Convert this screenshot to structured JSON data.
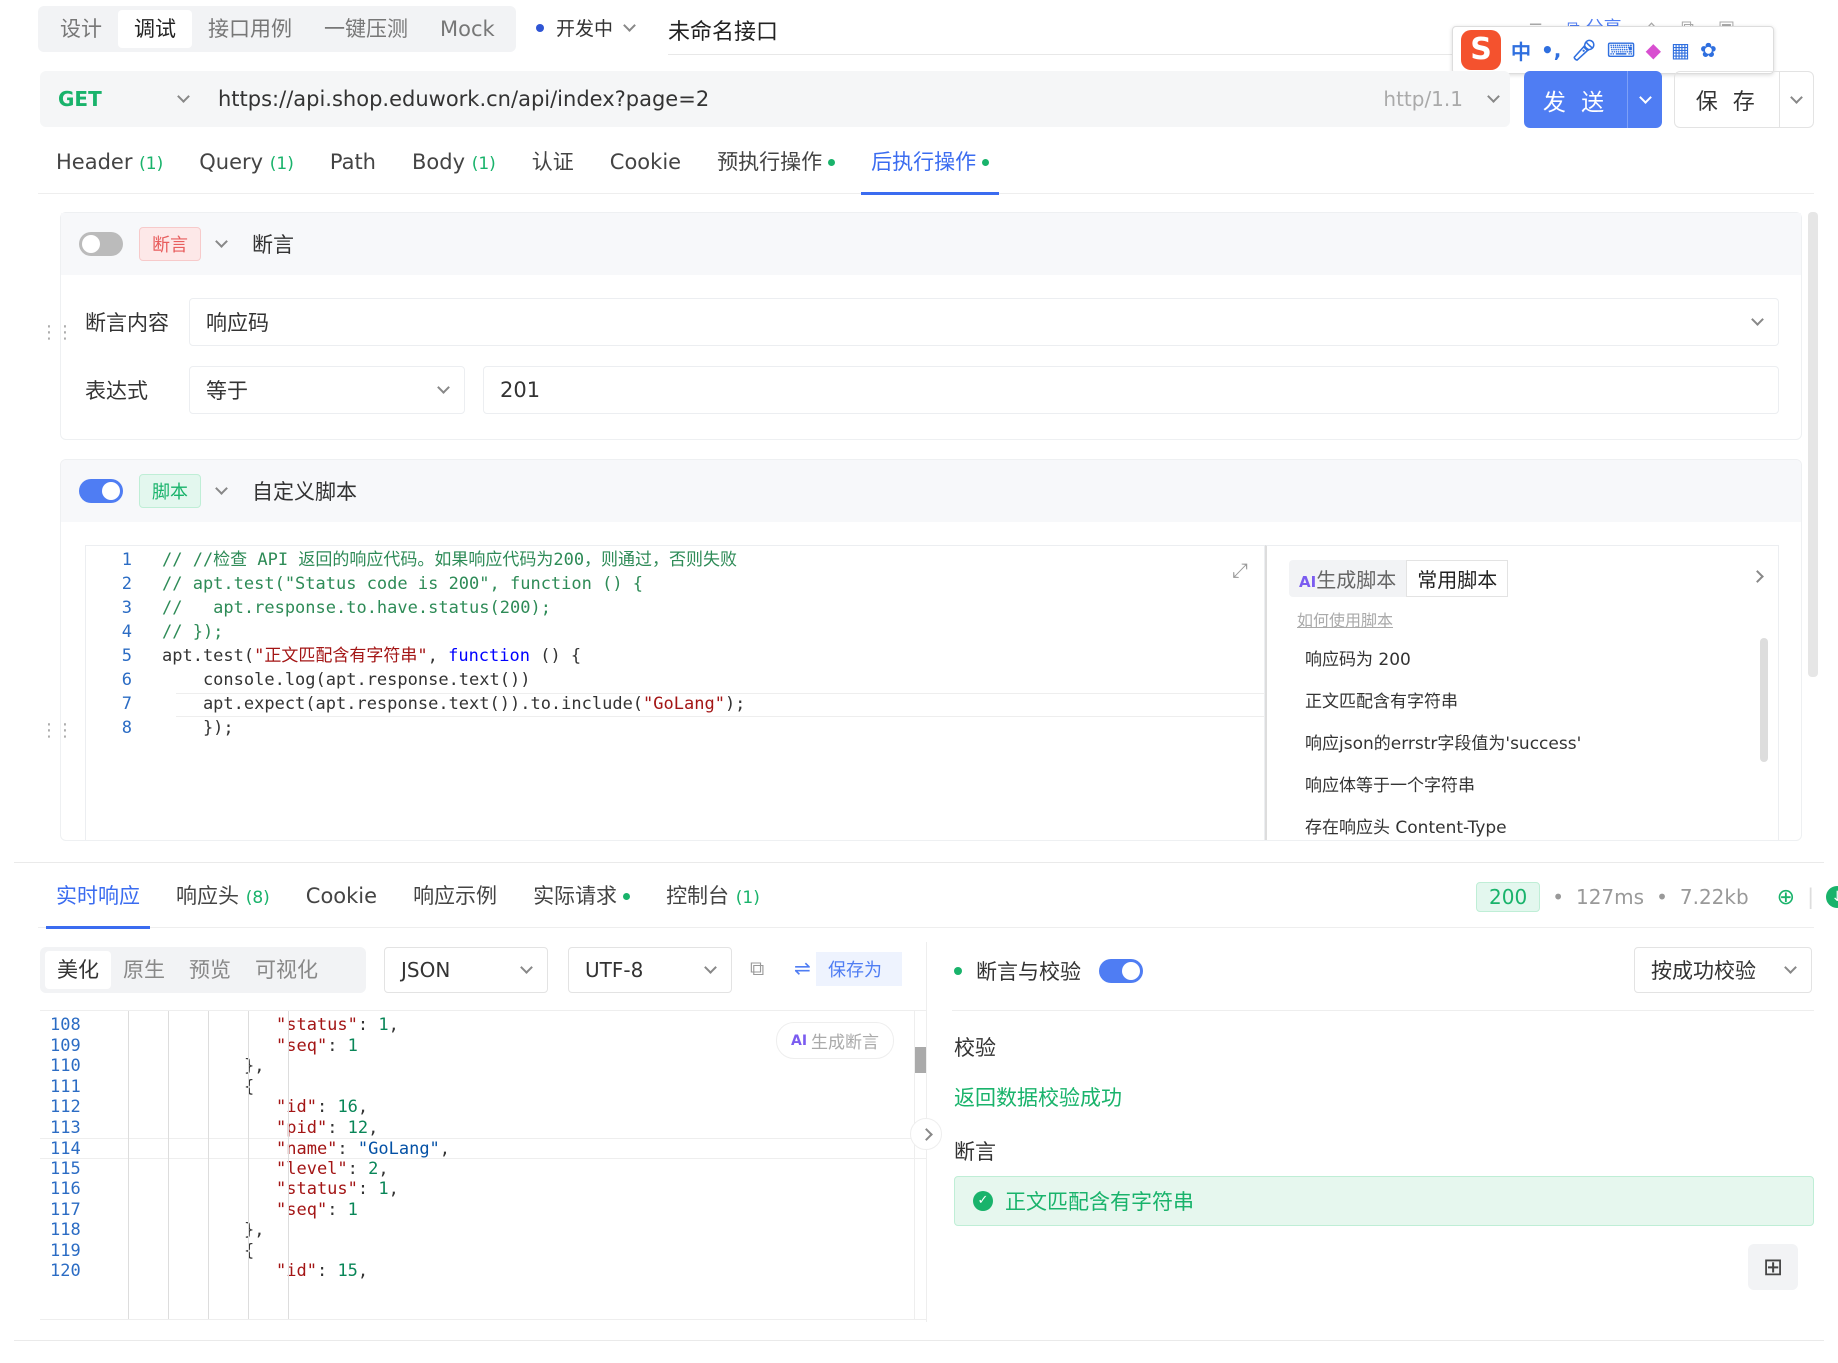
{
  "top_tabs": [
    "设计",
    "调试",
    "接口用例",
    "一键压测",
    "Mock"
  ],
  "active_top_tab": 1,
  "status": {
    "label": "开发中",
    "color": "#2f55d4"
  },
  "api_name": "未命名接口",
  "top_right_labels": {
    "share": "分享"
  },
  "ime": {
    "logo": "S",
    "lang": "中"
  },
  "request": {
    "method": "GET",
    "url": "https://api.shop.eduwork.cn/api/index?page=2",
    "protocol": "http/1.1",
    "send_label": "发 送",
    "save_label": "保 存"
  },
  "req_tabs": [
    {
      "label": "Header",
      "count": "(1)"
    },
    {
      "label": "Query",
      "count": "(1)"
    },
    {
      "label": "Path",
      "count": ""
    },
    {
      "label": "Body",
      "count": "(1)"
    },
    {
      "label": "认证",
      "count": ""
    },
    {
      "label": "Cookie",
      "count": ""
    },
    {
      "label": "预执行操作",
      "count": ""
    },
    {
      "label": "后执行操作",
      "count": ""
    }
  ],
  "assertion": {
    "tag": "断言",
    "title": "断言",
    "content_label": "断言内容",
    "content_value": "响应码",
    "expr_label": "表达式",
    "expr_value": "等于",
    "value": "201"
  },
  "script": {
    "tag": "脚本",
    "title": "自定义脚本",
    "ai_label": "生成脚本",
    "common_label": "常用脚本",
    "help_link": "如何使用脚本",
    "snippets": [
      "响应码为 200",
      "正文匹配含有字符串",
      "响应json的errstr字段值为'success'",
      "响应体等于一个字符串",
      "存在响应头 Content-Type"
    ],
    "code_lines": [
      {
        "n": "1",
        "text": "// //检查 API 返回的响应代码。如果响应代码为200，则通过，否则失败"
      },
      {
        "n": "2",
        "text": "// apt.test(\"Status code is 200\", function () {"
      },
      {
        "n": "3",
        "text": "//   apt.response.to.have.status(200);"
      },
      {
        "n": "4",
        "text": "// });"
      },
      {
        "n": "5",
        "pre": "apt.test(",
        "str": "\"正文匹配含有字符串\"",
        "mid": ", ",
        "kw": "function",
        "post": " () {"
      },
      {
        "n": "6",
        "text": "    console.log(apt.response.text())"
      },
      {
        "n": "7",
        "pre": "    apt.expect(apt.response.text()).to.include(",
        "str": "\"GoLang\"",
        "post": ");"
      },
      {
        "n": "8",
        "text": "    });"
      }
    ]
  },
  "resp_tabs": [
    {
      "label": "实时响应",
      "count": ""
    },
    {
      "label": "响应头",
      "count": "(8)"
    },
    {
      "label": "Cookie",
      "count": ""
    },
    {
      "label": "响应示例",
      "count": ""
    },
    {
      "label": "实际请求",
      "count": ""
    },
    {
      "label": "控制台",
      "count": "(1)"
    }
  ],
  "resp_stats": {
    "code": "200",
    "time": "127ms",
    "size": "7.22kb"
  },
  "view_modes": [
    "美化",
    "原生",
    "预览",
    "可视化"
  ],
  "format": "JSON",
  "encoding": "UTF-8",
  "save_as": "保存为",
  "gen_assert": "生成断言",
  "json_lines": [
    {
      "n": "108",
      "indent": 4,
      "k": "\"status\"",
      "v": "1",
      "t": "n",
      "tail": ","
    },
    {
      "n": "109",
      "indent": 4,
      "k": "\"seq\"",
      "v": "1",
      "t": "n",
      "tail": ""
    },
    {
      "n": "110",
      "indent": 3,
      "raw": "},"
    },
    {
      "n": "111",
      "indent": 3,
      "raw": "{"
    },
    {
      "n": "112",
      "indent": 4,
      "k": "\"id\"",
      "v": "16",
      "t": "n",
      "tail": ","
    },
    {
      "n": "113",
      "indent": 4,
      "k": "\"pid\"",
      "v": "12",
      "t": "n",
      "tail": ","
    },
    {
      "n": "114",
      "indent": 4,
      "k": "\"name\"",
      "v": "\"GoLang\"",
      "t": "s",
      "tail": ","
    },
    {
      "n": "115",
      "indent": 4,
      "k": "\"level\"",
      "v": "2",
      "t": "n",
      "tail": ","
    },
    {
      "n": "116",
      "indent": 4,
      "k": "\"status\"",
      "v": "1",
      "t": "n",
      "tail": ","
    },
    {
      "n": "117",
      "indent": 4,
      "k": "\"seq\"",
      "v": "1",
      "t": "n",
      "tail": ""
    },
    {
      "n": "118",
      "indent": 3,
      "raw": "},"
    },
    {
      "n": "119",
      "indent": 3,
      "raw": "{"
    },
    {
      "n": "120",
      "indent": 4,
      "k": "\"id\"",
      "v": "15",
      "t": "n",
      "tail": ","
    }
  ],
  "check_panel": {
    "title": "断言与校验",
    "mode": "按成功校验",
    "validate_label": "校验",
    "validate_result": "返回数据校验成功",
    "assert_label": "断言",
    "assert_result": "正文匹配含有字符串"
  }
}
